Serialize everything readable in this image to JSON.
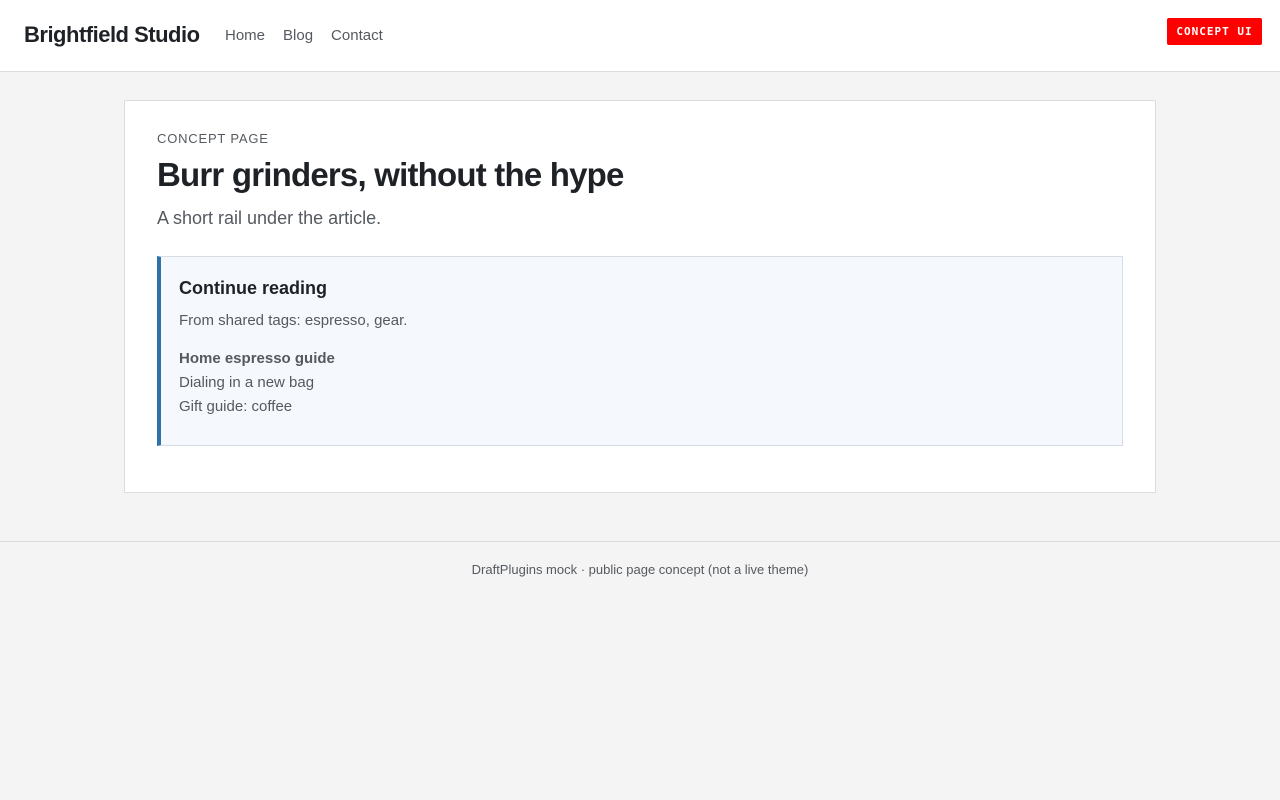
{
  "header": {
    "brand": "Brightfield Studio",
    "nav": [
      "Home",
      "Blog",
      "Contact"
    ],
    "badge": "CONCEPT UI"
  },
  "main": {
    "eyebrow": "CONCEPT PAGE",
    "title": "Burr grinders, without the hype",
    "subtitle": "A short rail under the article.",
    "rail": {
      "title": "Continue reading",
      "description": "From shared tags: espresso, gear.",
      "items": [
        "Home espresso guide",
        "Dialing in a new bag",
        "Gift guide: coffee"
      ]
    }
  },
  "footer": {
    "text": "DraftPlugins mock · public page concept (not a live theme)"
  },
  "colors": {
    "accent": "#2f72a8",
    "badge": "#ff0000",
    "page_background": "#f4f4f4",
    "rail_background": "#f5f9fd"
  }
}
